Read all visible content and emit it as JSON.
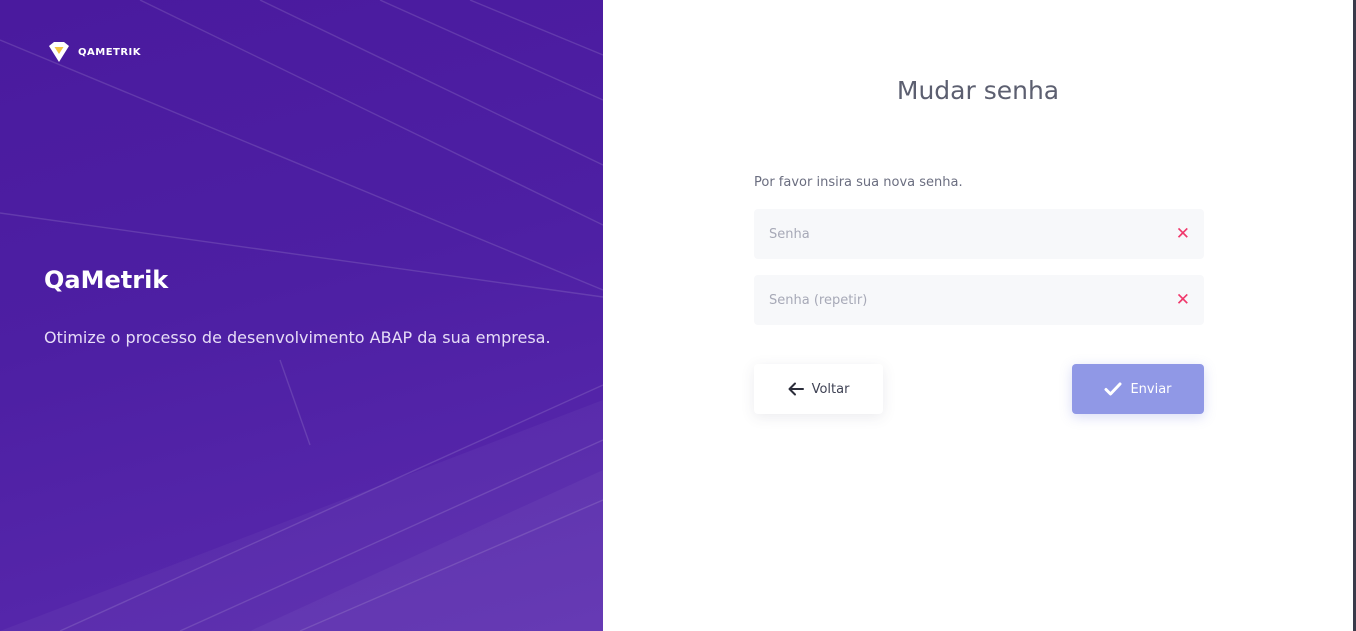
{
  "brand": {
    "logo_text": "QAMETRIK",
    "title": "QaMetrik",
    "tagline": "Otimize o processo de desenvolvimento ABAP da sua empresa."
  },
  "form": {
    "title": "Mudar senha",
    "instruction": "Por favor insira sua nova senha.",
    "password_placeholder": "Senha",
    "password_repeat_placeholder": "Senha (repetir)",
    "password_value": "",
    "password_repeat_value": "",
    "clear_icon": "close-icon"
  },
  "buttons": {
    "back_label": "Voltar",
    "back_icon": "arrow-left-icon",
    "submit_label": "Enviar",
    "submit_icon": "check-icon"
  },
  "colors": {
    "panel_purple": "#4d1fa3",
    "submit_button": "#9098e6",
    "clear_icon": "#f0386b",
    "logo_accent": "#f4c542"
  }
}
